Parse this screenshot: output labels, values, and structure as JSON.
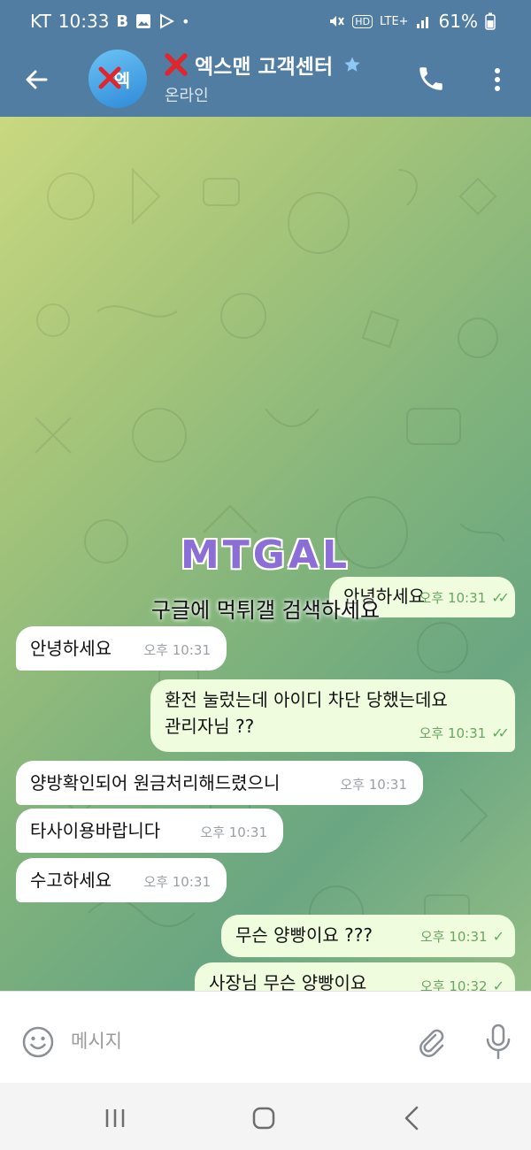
{
  "status_bar": {
    "carrier": "KT",
    "time": "10:33",
    "hd_label": "HD",
    "network": "LTE+",
    "battery": "61%"
  },
  "header": {
    "avatar_label": "엑",
    "title": "엑스맨 고객센터",
    "subtitle": "온라인"
  },
  "watermark": {
    "logo": "MTGAL",
    "text": "구글에 먹튀갤 검색하세요"
  },
  "messages": [
    {
      "dir": "out",
      "text": "안녕하세요",
      "time": "오후 10:31",
      "read": true
    },
    {
      "dir": "in",
      "text": "안녕하세요",
      "time": "오후 10:31"
    },
    {
      "dir": "out",
      "line1": "환전 눌렀는데 아이디 차단 당했는데요",
      "line2": "관리자님 ??",
      "time": "오후 10:31",
      "read": true
    },
    {
      "dir": "in",
      "text": "양방확인되어 원금처리해드렸으니",
      "time": "오후 10:31"
    },
    {
      "dir": "in",
      "text": "타사이용바랍니다",
      "time": "오후 10:31"
    },
    {
      "dir": "in",
      "text": "수고하세요",
      "time": "오후 10:31"
    },
    {
      "dir": "out",
      "text": "무슨 양빵이요 ???",
      "time": "오후 10:31",
      "read": false
    },
    {
      "dir": "out",
      "text": "사장님 무슨 양빵이요",
      "time": "오후 10:32",
      "read": false
    }
  ],
  "input": {
    "placeholder": "메시지",
    "value": ""
  },
  "icons": {
    "back": "arrow-left-icon",
    "star": "star-icon",
    "call": "phone-icon",
    "more": "more-vertical-icon",
    "emoji": "smiley-icon",
    "attach": "paperclip-icon",
    "mic": "microphone-icon"
  },
  "colors": {
    "header": "#517da2",
    "outgoing_bubble": "#effdde",
    "incoming_bubble": "#ffffff",
    "check": "#5fae60",
    "brand_x": "#e0262a"
  }
}
